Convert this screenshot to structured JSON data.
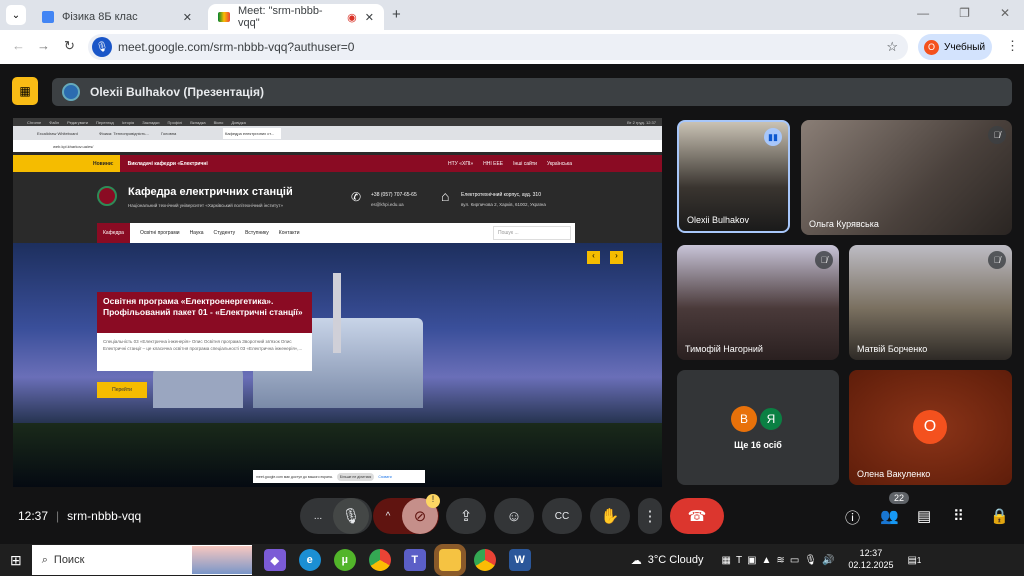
{
  "browser": {
    "tabs": [
      {
        "title": "Фізика 8Б клас"
      },
      {
        "title": "Meet: \"srm-nbbb-vqq\""
      }
    ],
    "url": "meet.google.com/srm-nbbb-vqq?authuser=0",
    "profile_initial": "О",
    "profile_name": "Учебный"
  },
  "meet": {
    "presenter_label": "Olexii Bulhakov (Презентація)",
    "time": "12:37",
    "meeting_code": "srm-nbbb-vqq",
    "participants_count": "22",
    "more_label": "...",
    "shared": {
      "inner_tabs": [
        "Excalidraw Whiteboard",
        "Фізика: Теплопровідність...",
        "Головна",
        "Кафедра електричних ст..."
      ],
      "inner_url": "web.kpi.kharkov.ua/es/",
      "mac_menu": [
        "Chrome",
        "Файл",
        "Редагувати",
        "Перегляд",
        "Історія",
        "Закладки",
        "Профілі",
        "Вкладка",
        "Вікно",
        "Довідка"
      ],
      "mac_clock": "Вт 2 груд. 12:37",
      "news_label": "Новини:",
      "news_text": "Викладачі кафедри «Електричні",
      "top_links": [
        "НТУ «ХПІ»",
        "ННІ ЕЕЕ",
        "Інші сайти",
        "Українська"
      ],
      "site_title": "Кафедра електричних станцій",
      "site_subtitle": "Національний технічний університет «Харківський політехнічний інститут»",
      "phone": "+38 (057) 707-65-65",
      "email": "es@khpi.edu.ua",
      "address_title": "Електротехнічний корпус, ауд. 310",
      "address": "вул. Кирпичова 2, Харків, 61002, Україна",
      "nav": [
        "Кафедра",
        "Освітні програми",
        "Наука",
        "Студенту",
        "Вступнику",
        "Контакти"
      ],
      "search_placeholder": "Пошук ...",
      "hero_title": "Освітня програма «Електроенергетика». Профільований пакет 01 - «Електричні станції»",
      "hero_text": "Спеціальність 03 «Електрична інженерія» Опис Освітня програма Зворотний зв'язок Опис Електричні станції – це класична освітня програма спеціальності 03 «Електрична інженерія»,...",
      "hero_button": "Перейти",
      "share_notice": "meet.google.com має доступ до вашого екрана.",
      "share_stop": "Більше не ділитися",
      "share_hide": "Сховати"
    },
    "participants": [
      {
        "name": "Olexii Bulhakov"
      },
      {
        "name": "Ольга Курявська"
      },
      {
        "name": "Тимофій Нагорний"
      },
      {
        "name": "Матвій Борченко"
      },
      {
        "name": "Олена Вакуленко",
        "initial": "О"
      }
    ],
    "others": {
      "initials": [
        "В",
        "Я"
      ],
      "label": "Ще 16 осіб"
    }
  },
  "taskbar": {
    "search": "Поиск",
    "weather": "3°C  Cloudy",
    "time": "12:37",
    "date": "02.12.2025",
    "notif": "1"
  },
  "colors": {
    "accent": "#8a0b23",
    "yellow": "#f5bc00",
    "end_call": "#dc362e"
  }
}
